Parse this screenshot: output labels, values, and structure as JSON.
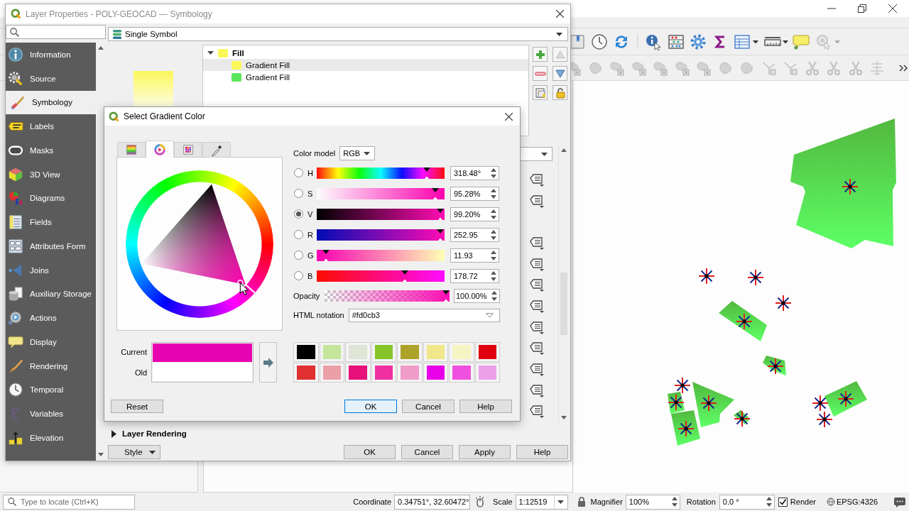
{
  "main_window": {
    "status_bar": {
      "locator_placeholder": "Type to locate (Ctrl+K)",
      "coordinate_label": "Coordinate",
      "coordinate": "0.34751°, 32.60472°",
      "scale_label": "Scale",
      "scale": "1:12519",
      "magnifier_label": "Magnifier",
      "magnifier": "100%",
      "rotation_label": "Rotation",
      "rotation": "0.0 °",
      "render_label": "Render",
      "render_checked": true,
      "crs": "EPSG:4326"
    }
  },
  "layer_properties": {
    "title": "Layer Properties - POLY-GEOCAD — Symbology",
    "renderer": "Single Symbol",
    "sidebar": [
      {
        "label": "Information",
        "selected": false
      },
      {
        "label": "Source",
        "selected": false
      },
      {
        "label": "Symbology",
        "selected": true
      },
      {
        "label": "Labels",
        "selected": false
      },
      {
        "label": "Masks",
        "selected": false
      },
      {
        "label": "3D View",
        "selected": false
      },
      {
        "label": "Diagrams",
        "selected": false
      },
      {
        "label": "Fields",
        "selected": false
      },
      {
        "label": "Attributes Form",
        "selected": false
      },
      {
        "label": "Joins",
        "selected": false
      },
      {
        "label": "Auxiliary Storage",
        "selected": false
      },
      {
        "label": "Actions",
        "selected": false
      },
      {
        "label": "Display",
        "selected": false
      },
      {
        "label": "Rendering",
        "selected": false
      },
      {
        "label": "Temporal",
        "selected": false
      },
      {
        "label": "Variables",
        "selected": false
      },
      {
        "label": "Elevation",
        "selected": false
      }
    ],
    "symbol_tree": [
      {
        "label": "Fill",
        "color": "#fbf75a",
        "expanded": true,
        "selected": false,
        "children": [
          {
            "label": "Gradient Fill",
            "color": "#fbf75a",
            "selected": true
          },
          {
            "label": "Gradient Fill",
            "color": "#5ae65a",
            "selected": false
          }
        ]
      }
    ],
    "layer_rendering": {
      "label": "Layer Rendering",
      "expanded": false
    },
    "style_button": "Style",
    "buttons": [
      {
        "label": "OK",
        "default": false
      },
      {
        "label": "Cancel",
        "default": false
      },
      {
        "label": "Apply",
        "default": false
      },
      {
        "label": "Help",
        "default": false
      }
    ]
  },
  "gradient_dialog": {
    "title": "Select Gradient Color",
    "tabs": [
      {
        "selected": false
      },
      {
        "selected": true
      },
      {
        "selected": false
      },
      {
        "selected": false
      }
    ],
    "color_model_label": "Color model",
    "color_model": "RGB",
    "channels": [
      {
        "kind": "hue",
        "label": "H",
        "value": "318.48°",
        "level": 0.885,
        "selected": false
      },
      {
        "kind": "saturation",
        "label": "S",
        "value": "95.28%",
        "level": 0.953,
        "selected": false
      },
      {
        "kind": "value",
        "label": "V",
        "value": "99.20%",
        "level": 0.992,
        "selected": true
      },
      {
        "kind": "red",
        "label": "R",
        "value": "252.95",
        "level": 0.992,
        "selected": false
      },
      {
        "kind": "green",
        "label": "G",
        "value": "11.93",
        "level": 0.047,
        "selected": false
      },
      {
        "kind": "blue",
        "label": "B",
        "value": "178.72",
        "level": 0.701,
        "selected": false
      }
    ],
    "opacity": {
      "label": "Opacity",
      "value": "100.00%",
      "level": 1
    },
    "html_notation": {
      "label": "HTML notation",
      "value": "#fd0cb3"
    },
    "preview": [
      {
        "label": "Current",
        "color": "#e804b0"
      },
      {
        "label": "Old",
        "color": "#ffffff"
      }
    ],
    "swatches": [
      {
        "color": "#000000"
      },
      {
        "color": "#c4e59a"
      },
      {
        "color": "#dfe6d5"
      },
      {
        "color": "#86c42a"
      },
      {
        "color": "#ada22a"
      },
      {
        "color": "#f0e68a"
      },
      {
        "color": "#f7f4c4"
      },
      {
        "color": "#e0000f"
      },
      {
        "color": "#e03030"
      },
      {
        "color": "#eba0a8"
      },
      {
        "color": "#e8107a"
      },
      {
        "color": "#f030a0"
      },
      {
        "color": "#f09cc8"
      },
      {
        "color": "#e800e8"
      },
      {
        "color": "#f050e0"
      },
      {
        "color": "#eca0e8"
      }
    ],
    "reset": "Reset",
    "buttons": [
      {
        "label": "OK",
        "default": true
      },
      {
        "label": "Cancel",
        "default": false
      },
      {
        "label": "Help",
        "default": false
      }
    ]
  }
}
